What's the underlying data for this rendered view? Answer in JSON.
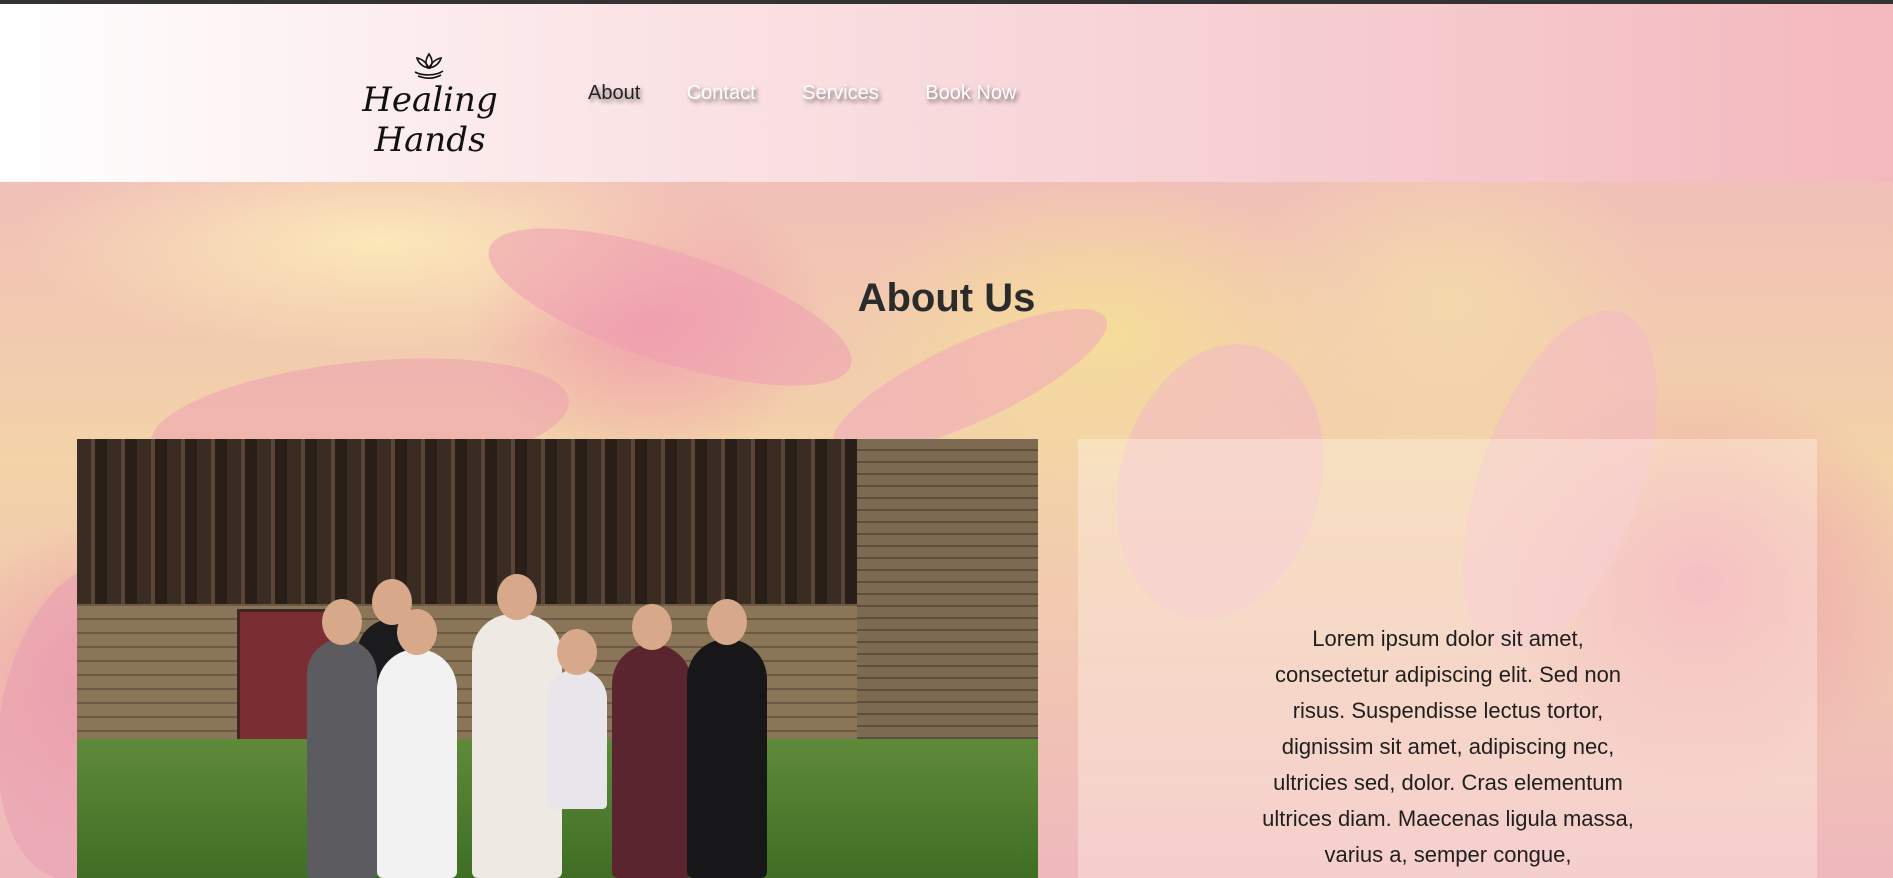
{
  "header": {
    "logo_text": "Healing Hands",
    "nav": [
      {
        "label": "About",
        "active": true
      },
      {
        "label": "Contact",
        "active": false
      },
      {
        "label": "Services",
        "active": false
      },
      {
        "label": "Book Now",
        "active": false
      }
    ]
  },
  "main": {
    "title": "About Us",
    "body": "Lorem ipsum dolor sit amet, consectetur adipiscing elit. Sed non risus. Suspendisse lectus tortor, dignissim sit amet, adipiscing nec, ultricies sed, dolor. Cras elementum ultrices diam. Maecenas ligula massa, varius a, semper congue,"
  },
  "colors": {
    "header_gradient_end": "#f3b9be",
    "text_dark": "#2b2b2b",
    "nav_text": "#ffffff"
  },
  "icons": {
    "logo": "lotus-hand-icon"
  }
}
